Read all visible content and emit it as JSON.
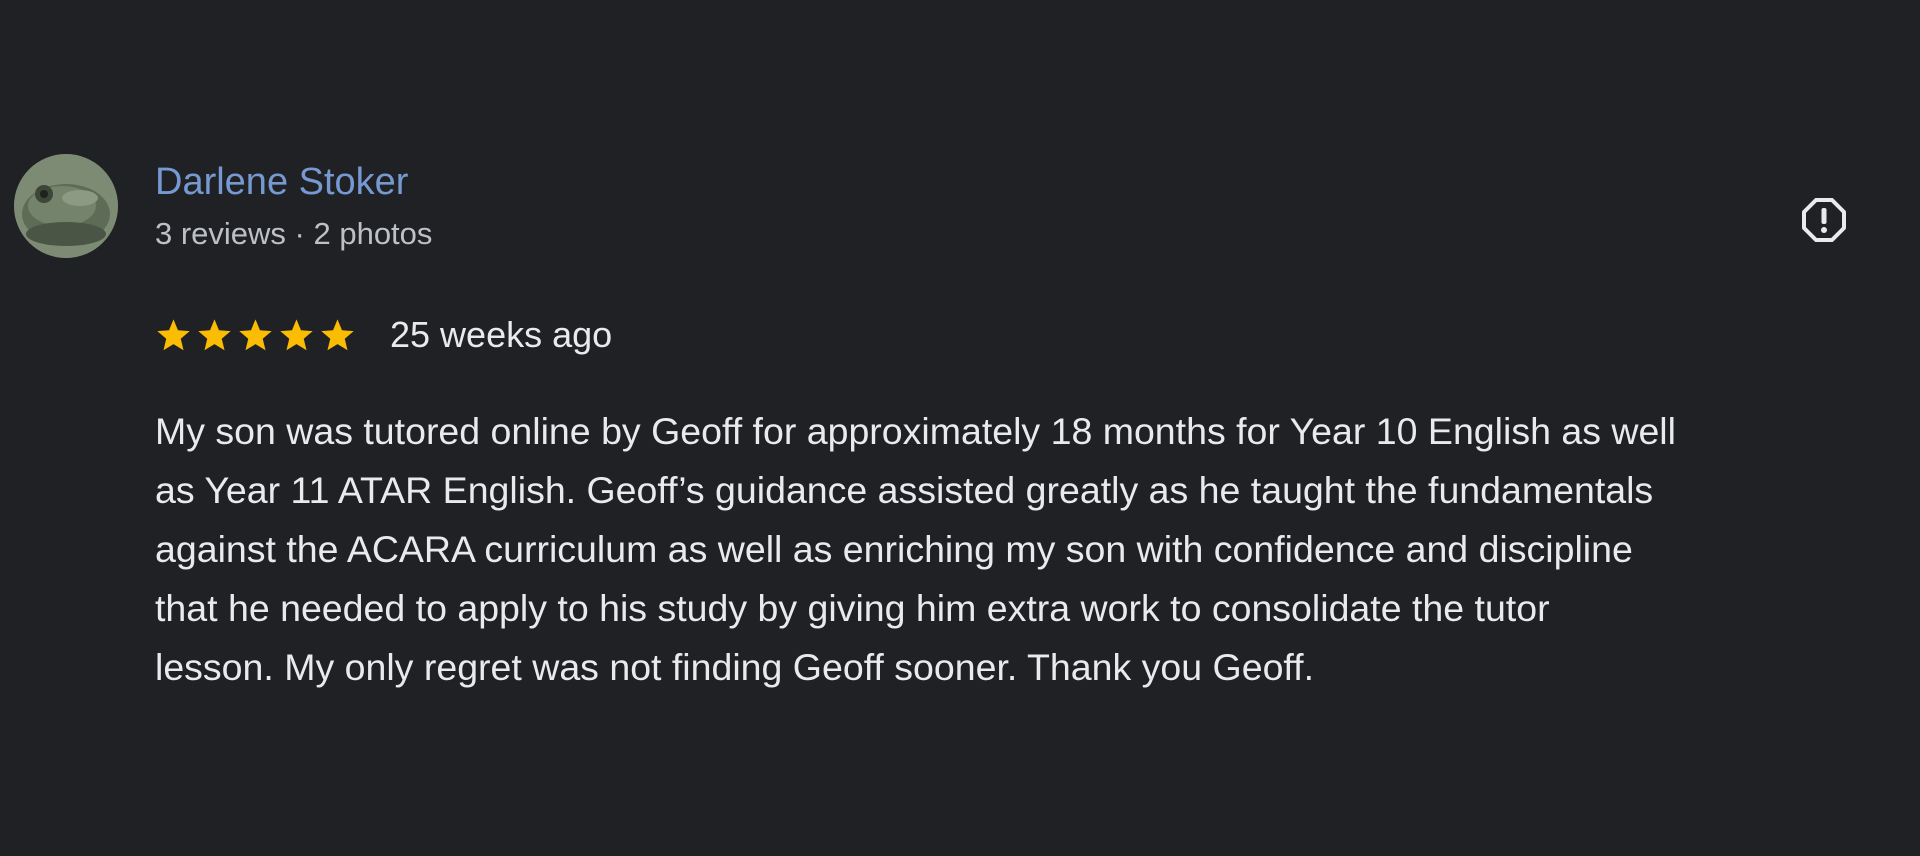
{
  "review": {
    "author": {
      "name": "Darlene Stoker",
      "meta": "3 reviews · 2 photos",
      "avatar_icon": "frog-photo-avatar"
    },
    "rating": {
      "stars": 5,
      "max": 5,
      "star_color": "#fbbc04"
    },
    "date": "25 weeks ago",
    "text_lines": [
      "My son was tutored online by Geoff for approximately 18 months for Year 10 English as well",
      "as Year 11 ATAR English. Geoff’s guidance assisted greatly as he taught the fundamentals",
      "against the ACARA curriculum as well as enriching my son with confidence and discipline",
      "that he needed to apply to his study by giving him extra work to consolidate the tutor",
      "lesson. My only regret was not finding Geoff sooner. Thank you Geoff."
    ],
    "report_icon": "report-icon"
  },
  "colors": {
    "background": "#202124",
    "name": "#8ab4f8",
    "text": "#e8eaed",
    "meta": "#bdc1c6"
  }
}
